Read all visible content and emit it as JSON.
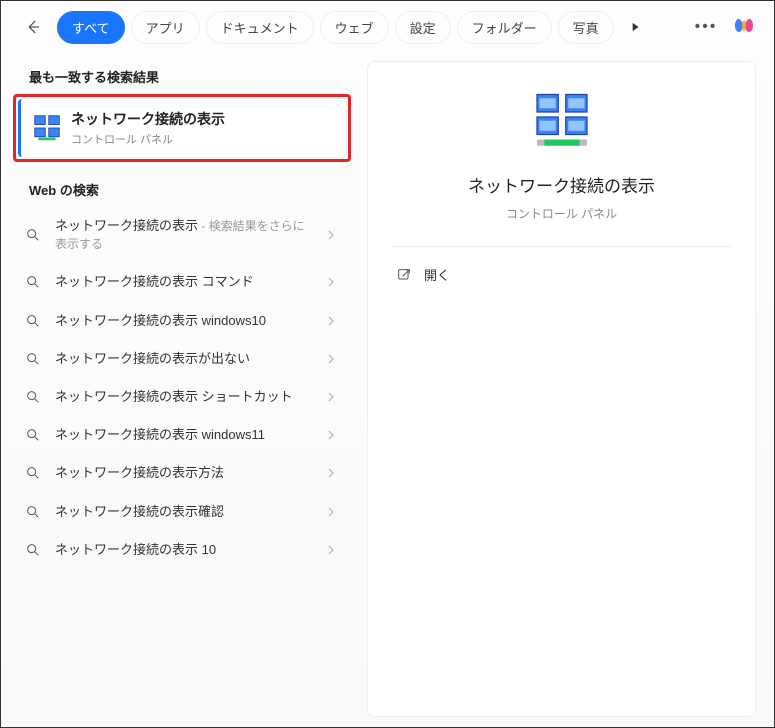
{
  "topbar": {
    "tabs": [
      {
        "label": "すべて",
        "active": true
      },
      {
        "label": "アプリ",
        "active": false
      },
      {
        "label": "ドキュメント",
        "active": false
      },
      {
        "label": "ウェブ",
        "active": false
      },
      {
        "label": "設定",
        "active": false
      },
      {
        "label": "フォルダー",
        "active": false
      },
      {
        "label": "写真",
        "active": false
      }
    ]
  },
  "left": {
    "best_match_header": "最も一致する検索結果",
    "best_match": {
      "title": "ネットワーク接続の表示",
      "subtitle": "コントロール パネル"
    },
    "web_header": "Web の検索",
    "web_items": [
      {
        "text": "ネットワーク接続の表示",
        "suffix": " - 検索結果をさらに表示する"
      },
      {
        "text": "ネットワーク接続の表示 コマンド",
        "suffix": ""
      },
      {
        "text": "ネットワーク接続の表示 windows10",
        "suffix": ""
      },
      {
        "text": "ネットワーク接続の表示が出ない",
        "suffix": ""
      },
      {
        "text": "ネットワーク接続の表示 ショートカット",
        "suffix": ""
      },
      {
        "text": "ネットワーク接続の表示 windows11",
        "suffix": ""
      },
      {
        "text": "ネットワーク接続の表示方法",
        "suffix": ""
      },
      {
        "text": "ネットワーク接続の表示確認",
        "suffix": ""
      },
      {
        "text": "ネットワーク接続の表示 10",
        "suffix": ""
      }
    ]
  },
  "right": {
    "title": "ネットワーク接続の表示",
    "subtitle": "コントロール パネル",
    "open_label": "開く"
  }
}
